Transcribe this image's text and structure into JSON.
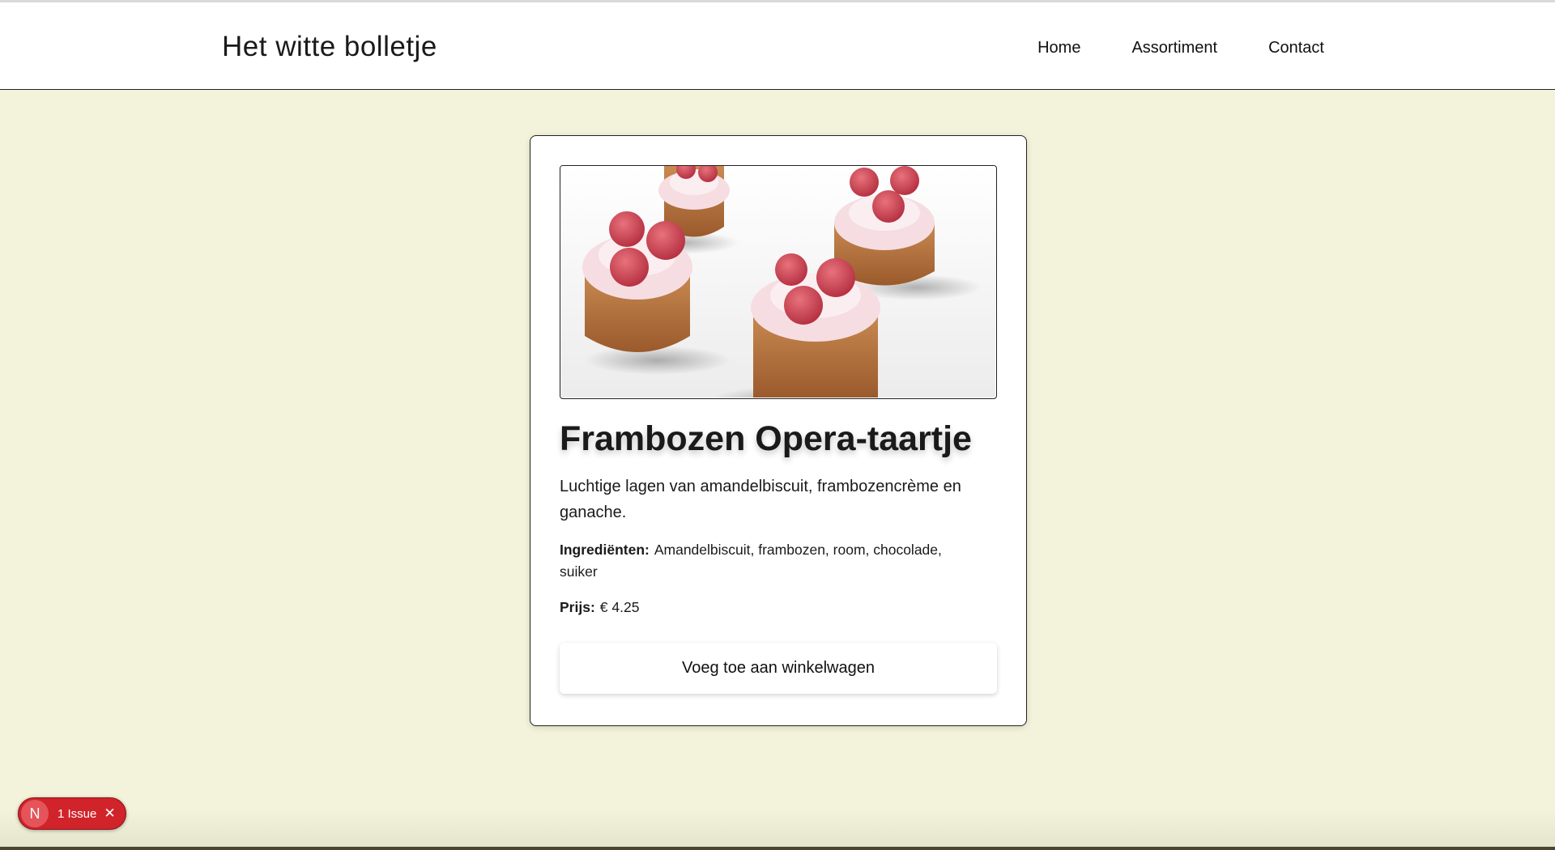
{
  "site": {
    "brand": "Het witte bolletje",
    "nav": [
      "Home",
      "Assortiment",
      "Contact"
    ]
  },
  "product": {
    "image_alt": "frambozen-taartjes",
    "title": "Frambozen Opera-taartje",
    "description": "Luchtige lagen van amandelbiscuit, frambozencrème en ganache.",
    "ingredients_label": "Ingrediënten:",
    "ingredients": "Amandelbiscuit, frambozen, room, chocolade, suiker",
    "price_label": "Prijs:",
    "price": "€ 4.25",
    "add_button": "Voeg toe aan winkelwagen"
  },
  "dev_overlay": {
    "logo_letter": "N",
    "issues_label": "1 Issue",
    "close_glyph": "✕"
  },
  "colors": {
    "page_background": "#f3f2da",
    "issue_badge": "#d1232a"
  }
}
